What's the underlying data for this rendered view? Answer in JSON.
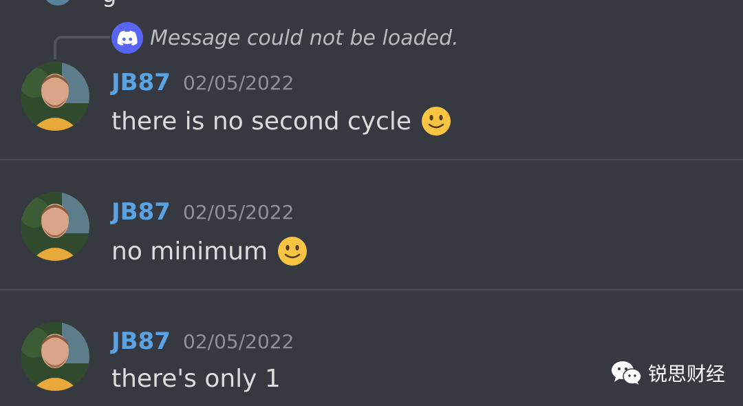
{
  "reply": {
    "text": "Message could not be loaded."
  },
  "messages": [
    {
      "username": "JB87",
      "timestamp": "02/05/2022",
      "text": "there is no second cycle",
      "emoji": "slightly-smiling-face"
    },
    {
      "username": "JB87",
      "timestamp": "02/05/2022",
      "text": "no minimum",
      "emoji": "slightly-smiling-face"
    },
    {
      "username": "JB87",
      "timestamp": "02/05/2022",
      "text": "there's only 1",
      "emoji": ""
    }
  ],
  "watermark": {
    "text": "锐思财经",
    "icon": "wechat-icon"
  },
  "colors": {
    "background": "#36393f",
    "username": "#5aa3e3",
    "reply_icon": "#5865f2"
  }
}
